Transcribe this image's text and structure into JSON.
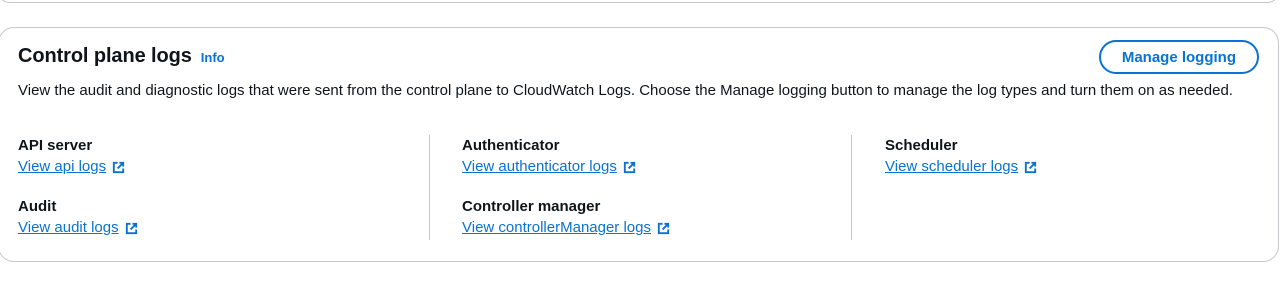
{
  "panel": {
    "title": "Control plane logs",
    "info_label": "Info",
    "manage_button_label": "Manage logging",
    "description": "View the audit and diagnostic logs that were sent from the control plane to CloudWatch Logs. Choose the Manage logging button to manage the log types and turn them on as needed."
  },
  "log_types": {
    "api_server": {
      "label": "API server",
      "link": "View api logs"
    },
    "audit": {
      "label": "Audit",
      "link": "View audit logs"
    },
    "authenticator": {
      "label": "Authenticator",
      "link": "View authenticator logs"
    },
    "controller_manager": {
      "label": "Controller manager",
      "link": "View controllerManager logs"
    },
    "scheduler": {
      "label": "Scheduler",
      "link": "View scheduler logs"
    }
  },
  "icons": {
    "external_link": "external-link-icon"
  },
  "colors": {
    "link": "#0972d3",
    "text": "#0f141a",
    "border": "#c6c6cd"
  }
}
